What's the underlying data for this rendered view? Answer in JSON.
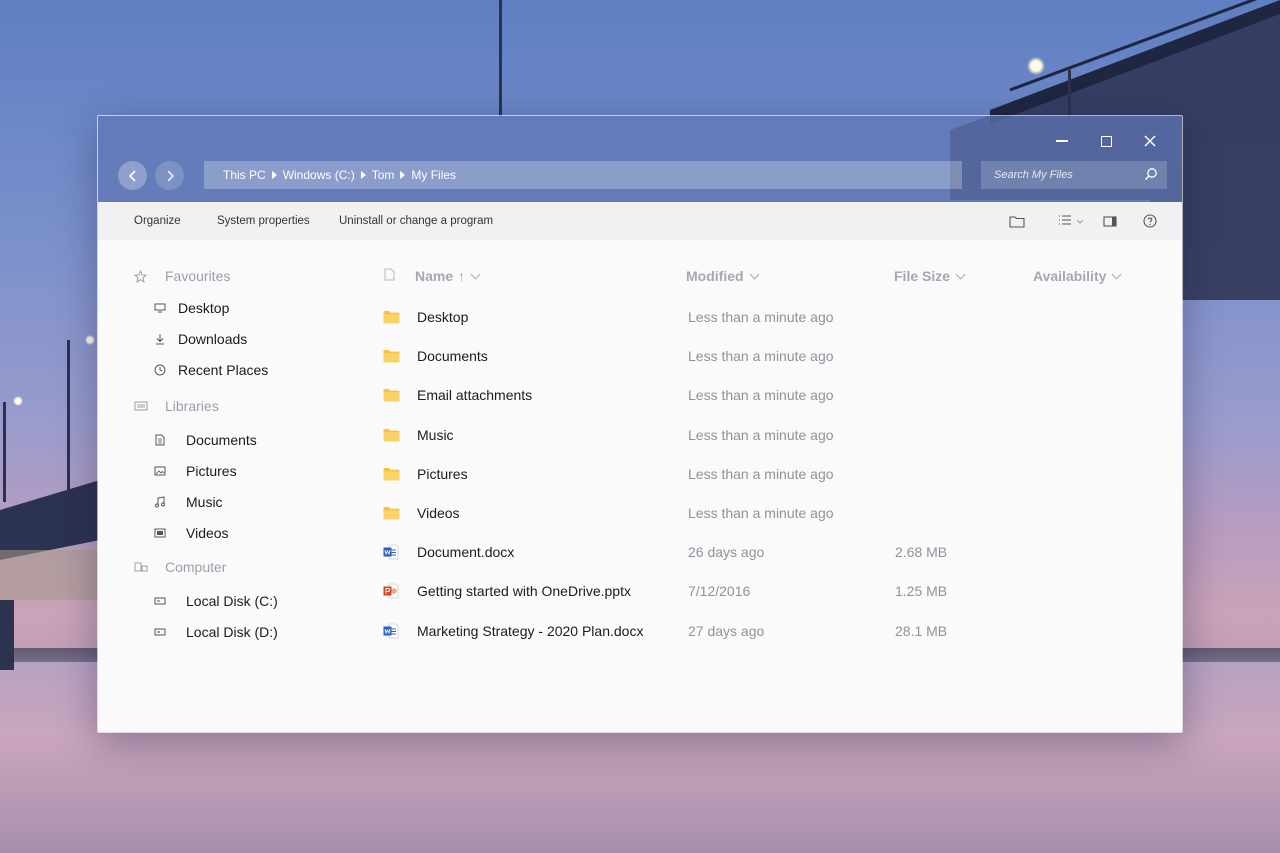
{
  "window": {
    "controls": {
      "minimize": "minimize-icon",
      "maximize": "maximize-icon",
      "close": "close-icon"
    }
  },
  "navigation": {
    "back_icon": "chevron-left-icon",
    "forward_icon": "chevron-right-icon"
  },
  "address": {
    "crumbs": [
      "This PC",
      "Windows (C:)",
      "Tom",
      "My Files"
    ]
  },
  "search": {
    "placeholder": "Search My Files",
    "icon": "search-icon"
  },
  "toolbar": {
    "organize": "Organize",
    "system_properties": "System properties",
    "uninstall": "Uninstall or change a program",
    "icons": [
      "new-folder-icon",
      "view-list-icon",
      "preview-pane-icon",
      "help-icon"
    ]
  },
  "sidebar": {
    "favourites": {
      "label": "Favourites",
      "icon": "star-icon",
      "items": [
        {
          "label": "Desktop",
          "icon": "monitor-icon"
        },
        {
          "label": "Downloads",
          "icon": "download-icon"
        },
        {
          "label": "Recent Places",
          "icon": "clock-icon"
        }
      ]
    },
    "libraries": {
      "label": "Libraries",
      "icon": "library-icon",
      "items": [
        {
          "label": "Documents",
          "icon": "document-icon"
        },
        {
          "label": "Pictures",
          "icon": "picture-icon"
        },
        {
          "label": "Music",
          "icon": "music-icon"
        },
        {
          "label": "Videos",
          "icon": "video-icon"
        }
      ]
    },
    "computer": {
      "label": "Computer",
      "icon": "computer-icon",
      "items": [
        {
          "label": "Local Disk (C:)",
          "icon": "drive-icon"
        },
        {
          "label": "Local Disk (D:)",
          "icon": "drive-icon"
        }
      ]
    }
  },
  "columns": {
    "name": "Name",
    "modified": "Modified",
    "size": "File Size",
    "availability": "Availability",
    "sort_indicator": "↑"
  },
  "files": [
    {
      "name": "Desktop",
      "modified": "Less than a minute ago",
      "size": "",
      "type": "folder"
    },
    {
      "name": "Documents",
      "modified": "Less than a minute ago",
      "size": "",
      "type": "folder"
    },
    {
      "name": "Email attachments",
      "modified": "Less than a minute ago",
      "size": "",
      "type": "folder"
    },
    {
      "name": "Music",
      "modified": "Less than a minute ago",
      "size": "",
      "type": "folder"
    },
    {
      "name": "Pictures",
      "modified": "Less than a minute ago",
      "size": "",
      "type": "folder"
    },
    {
      "name": "Videos",
      "modified": "Less than a minute ago",
      "size": "",
      "type": "folder"
    },
    {
      "name": "Document.docx",
      "modified": "26 days ago",
      "size": "2.68 MB",
      "type": "word"
    },
    {
      "name": "Getting started with OneDrive.pptx",
      "modified": "7/12/2016",
      "size": "1.25 MB",
      "type": "powerpoint"
    },
    {
      "name": "Marketing Strategy - 2020 Plan.docx",
      "modified": "27 days ago",
      "size": "28.1 MB",
      "type": "word"
    }
  ],
  "colors": {
    "folder": "#f5c242",
    "word": "#2b5fc1",
    "powerpoint": "#d24726",
    "titlebar": "#5f76b4"
  }
}
